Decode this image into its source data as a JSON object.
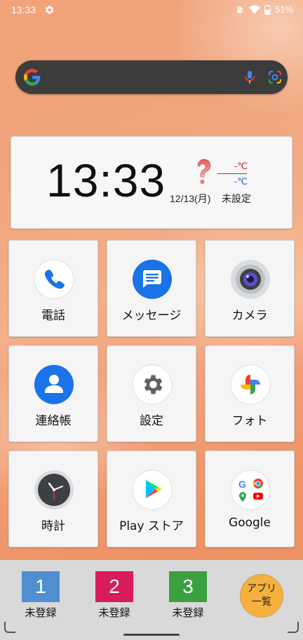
{
  "status_bar": {
    "time": "13:33",
    "battery": "51%"
  },
  "search": {
    "icons": [
      "google-g-icon",
      "mic-icon",
      "lens-icon"
    ]
  },
  "clock_widget": {
    "time": "13:33",
    "date": "12/13(月)",
    "temp_high": "-℃",
    "temp_low": "-℃",
    "location": "未設定"
  },
  "apps": [
    {
      "label": "電話",
      "icon": "phone-icon"
    },
    {
      "label": "メッセージ",
      "icon": "messages-icon"
    },
    {
      "label": "カメラ",
      "icon": "camera-icon"
    },
    {
      "label": "連絡帳",
      "icon": "contacts-icon"
    },
    {
      "label": "設定",
      "icon": "settings-icon"
    },
    {
      "label": "フォト",
      "icon": "photos-icon"
    },
    {
      "label": "時計",
      "icon": "clock-icon"
    },
    {
      "label": "Play ストア",
      "icon": "play-store-icon"
    },
    {
      "label": "Google",
      "icon": "google-folder-icon"
    }
  ],
  "dock": {
    "favorites": [
      {
        "number": "1",
        "label": "未登録",
        "color": "#4f8fcf"
      },
      {
        "number": "2",
        "label": "未登録",
        "color": "#d81b5a"
      },
      {
        "number": "3",
        "label": "未登録",
        "color": "#3aa040"
      }
    ],
    "app_list_line1": "アプリ",
    "app_list_line2": "一覧"
  },
  "colors": {
    "accent_orange": "#f5b03d",
    "blue": "#1a73e8"
  }
}
